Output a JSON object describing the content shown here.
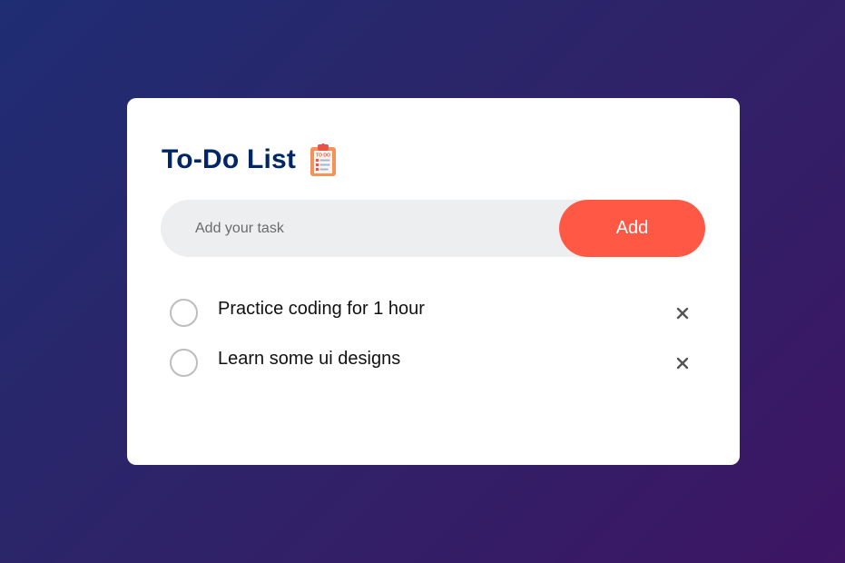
{
  "app": {
    "title": "To-Do List",
    "title_icon": "clipboard-todo-icon"
  },
  "input": {
    "placeholder": "Add your task",
    "value": ""
  },
  "add_button": {
    "label": "Add"
  },
  "tasks": [
    {
      "text": "Practice coding for 1 hour",
      "checked": false,
      "delete_icon": "close-icon"
    },
    {
      "text": "Learn some ui designs",
      "checked": false,
      "delete_icon": "close-icon"
    }
  ],
  "colors": {
    "background_start": "#1f2d73",
    "background_end": "#3d1564",
    "title": "#002765",
    "accent": "#ff5945",
    "input_bg": "#edeef0"
  }
}
